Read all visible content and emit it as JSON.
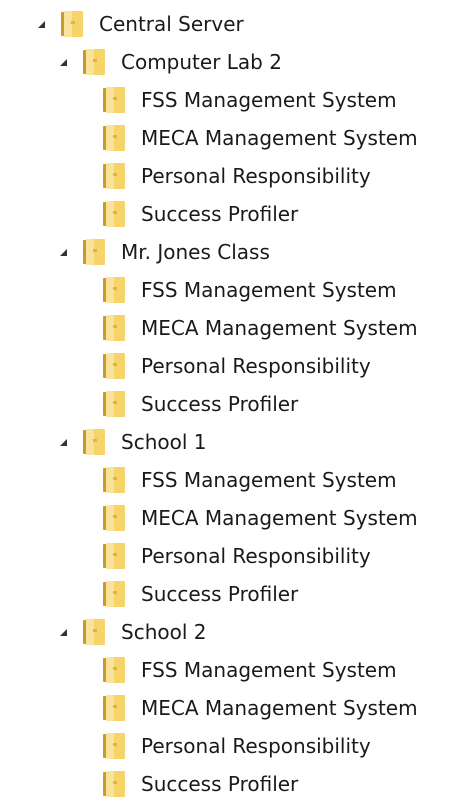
{
  "tree": {
    "root": {
      "label": "Central Server",
      "children": [
        {
          "label": "Computer Lab 2",
          "items": [
            "FSS Management System",
            "MECA Management System",
            "Personal Responsibility",
            "Success Profiler"
          ]
        },
        {
          "label": "Mr. Jones Class",
          "items": [
            "FSS Management System",
            "MECA Management System",
            "Personal Responsibility",
            "Success Profiler"
          ]
        },
        {
          "label": "School 1",
          "items": [
            "FSS Management System",
            "MECA Management System",
            "Personal Responsibility",
            "Success Profiler"
          ]
        },
        {
          "label": "School 2",
          "items": [
            "FSS Management System",
            "MECA Management System",
            "Personal Responsibility",
            "Success Profiler"
          ]
        }
      ]
    },
    "expand_icon": "collapse-triangle-icon",
    "folder_icon": "folder-icon",
    "colors": {
      "folder_light": "#f8dc77",
      "folder_dark": "#d7ad36",
      "toggle": "#333333",
      "text": "#1a1a1a"
    }
  }
}
